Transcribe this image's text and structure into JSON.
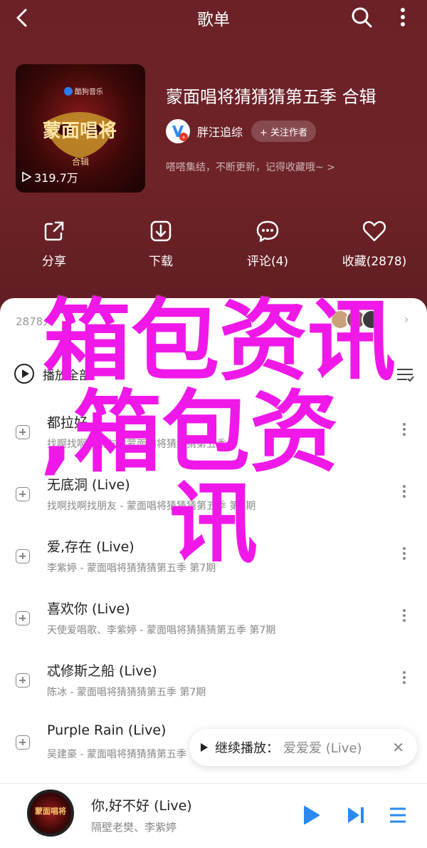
{
  "nav": {
    "title": "歌单"
  },
  "playlist": {
    "title": "蒙面唱将猜猜猜第五季 合辑",
    "play_count": "319.7万",
    "cover_label": "合辑",
    "cover_logo": "酷狗音乐",
    "creator": {
      "name": "胖汪追综",
      "follow_label": "+ 关注作者"
    },
    "description": "嗒嗒集结，不断更新，记得收藏哦~ >"
  },
  "actions": [
    {
      "label": "分享",
      "icon": "share-icon"
    },
    {
      "label": "下载",
      "icon": "download-icon"
    },
    {
      "label": "评论(4)",
      "icon": "comment-icon"
    },
    {
      "label": "收藏(2878)",
      "icon": "heart-icon"
    }
  ],
  "sheet": {
    "meta": "2878人",
    "play_all": "播放全部",
    "songs": [
      {
        "title": "都拉好",
        "sub": "找啊找啊找朋友 - 蒙面唱将猜猜猜第五季"
      },
      {
        "title": "无底洞 (Live)",
        "sub": "找啊找啊找朋友 - 蒙面唱将猜猜猜第五季 第7期"
      },
      {
        "title": "爱,存在 (Live)",
        "sub": "李紫婷 - 蒙面唱将猜猜猜第五季 第7期"
      },
      {
        "title": "喜欢你 (Live)",
        "sub": "天使爱唱歌、李紫婷 - 蒙面唱将猜猜猜第五季 第7期"
      },
      {
        "title": "忒修斯之船 (Live)",
        "sub": "陈冰 - 蒙面唱将猜猜猜第五季 第7期"
      },
      {
        "title": "Purple Rain (Live)",
        "sub": "吴建豪 - 蒙面唱将猜猜猜第五季"
      }
    ]
  },
  "overlay": {
    "line1": "箱包资讯",
    "line2": ",箱包资",
    "line3": "讯"
  },
  "toast": {
    "label": "继续播放：",
    "song": "爱爱爱 (Live)"
  },
  "player": {
    "title": "你,好不好 (Live)",
    "artist": "隔壁老樊、李紫婷",
    "cover_text": "蒙面唱将"
  },
  "colors": {
    "hero_bg": "#6b2127",
    "overlay_text": "#f018e8",
    "accent_blue": "#2a8af0"
  }
}
